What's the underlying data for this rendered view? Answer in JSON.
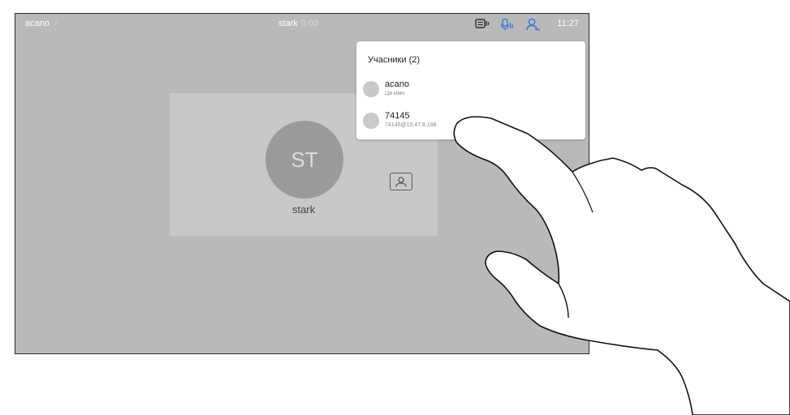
{
  "topbar": {
    "breadcrumb": "acano",
    "breadcrumb_chevron": "›",
    "call_name": "stark",
    "call_duration": "0:03",
    "icons": [
      "share-screen-icon",
      "microphone-icon",
      "participants-icon"
    ],
    "time": "11:27"
  },
  "tile": {
    "initials": "ST",
    "name": "stark"
  },
  "participants_panel": {
    "title": "Учасники (2)",
    "items": [
      {
        "name": "acano",
        "sub": "Ця кімн"
      },
      {
        "name": "74145",
        "sub": "74145@10.47.8.108"
      }
    ]
  },
  "colors": {
    "screen_bg": "#b9b9b9",
    "tile_bg": "#c8c8c8",
    "panel_bg": "#ffffff",
    "accent": "#3a7bd5"
  }
}
